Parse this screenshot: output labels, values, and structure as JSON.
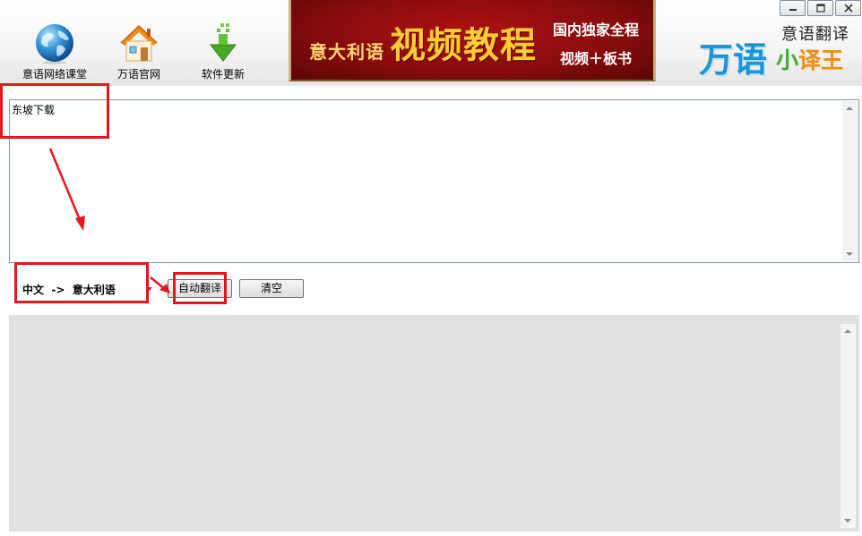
{
  "toolbar": {
    "items": [
      {
        "label": "意语网络课堂",
        "icon": "globe-icon"
      },
      {
        "label": "万语官网",
        "icon": "house-icon"
      },
      {
        "label": "软件更新",
        "icon": "download-arrow-icon"
      }
    ]
  },
  "banner": {
    "lang": "意大利语",
    "main": "视频教程",
    "sub1": "国内独家全程",
    "sub2": "视频＋板书"
  },
  "brand": {
    "tagline": "意语翻译",
    "name_part1": "万语",
    "name_part2_a": "小",
    "name_part2_b": "译王"
  },
  "window_controls": {
    "icons": [
      "minimize-icon",
      "maximize-icon",
      "close-icon"
    ]
  },
  "input": {
    "value": "东坡下载"
  },
  "controls": {
    "language_direction": "中文  ->  意大利语",
    "translate_button": "自动翻译",
    "clear_button": "清空"
  },
  "output": {
    "value": ""
  },
  "colors": {
    "banner_red": "#8a0c0d",
    "banner_gold": "#ffcc33",
    "brand_blue": "#1e93d8",
    "brand_orange": "#f18a17",
    "brand_green": "#3aab2e",
    "annotation_red": "#e8141b",
    "output_bg": "#e1e1e1"
  }
}
